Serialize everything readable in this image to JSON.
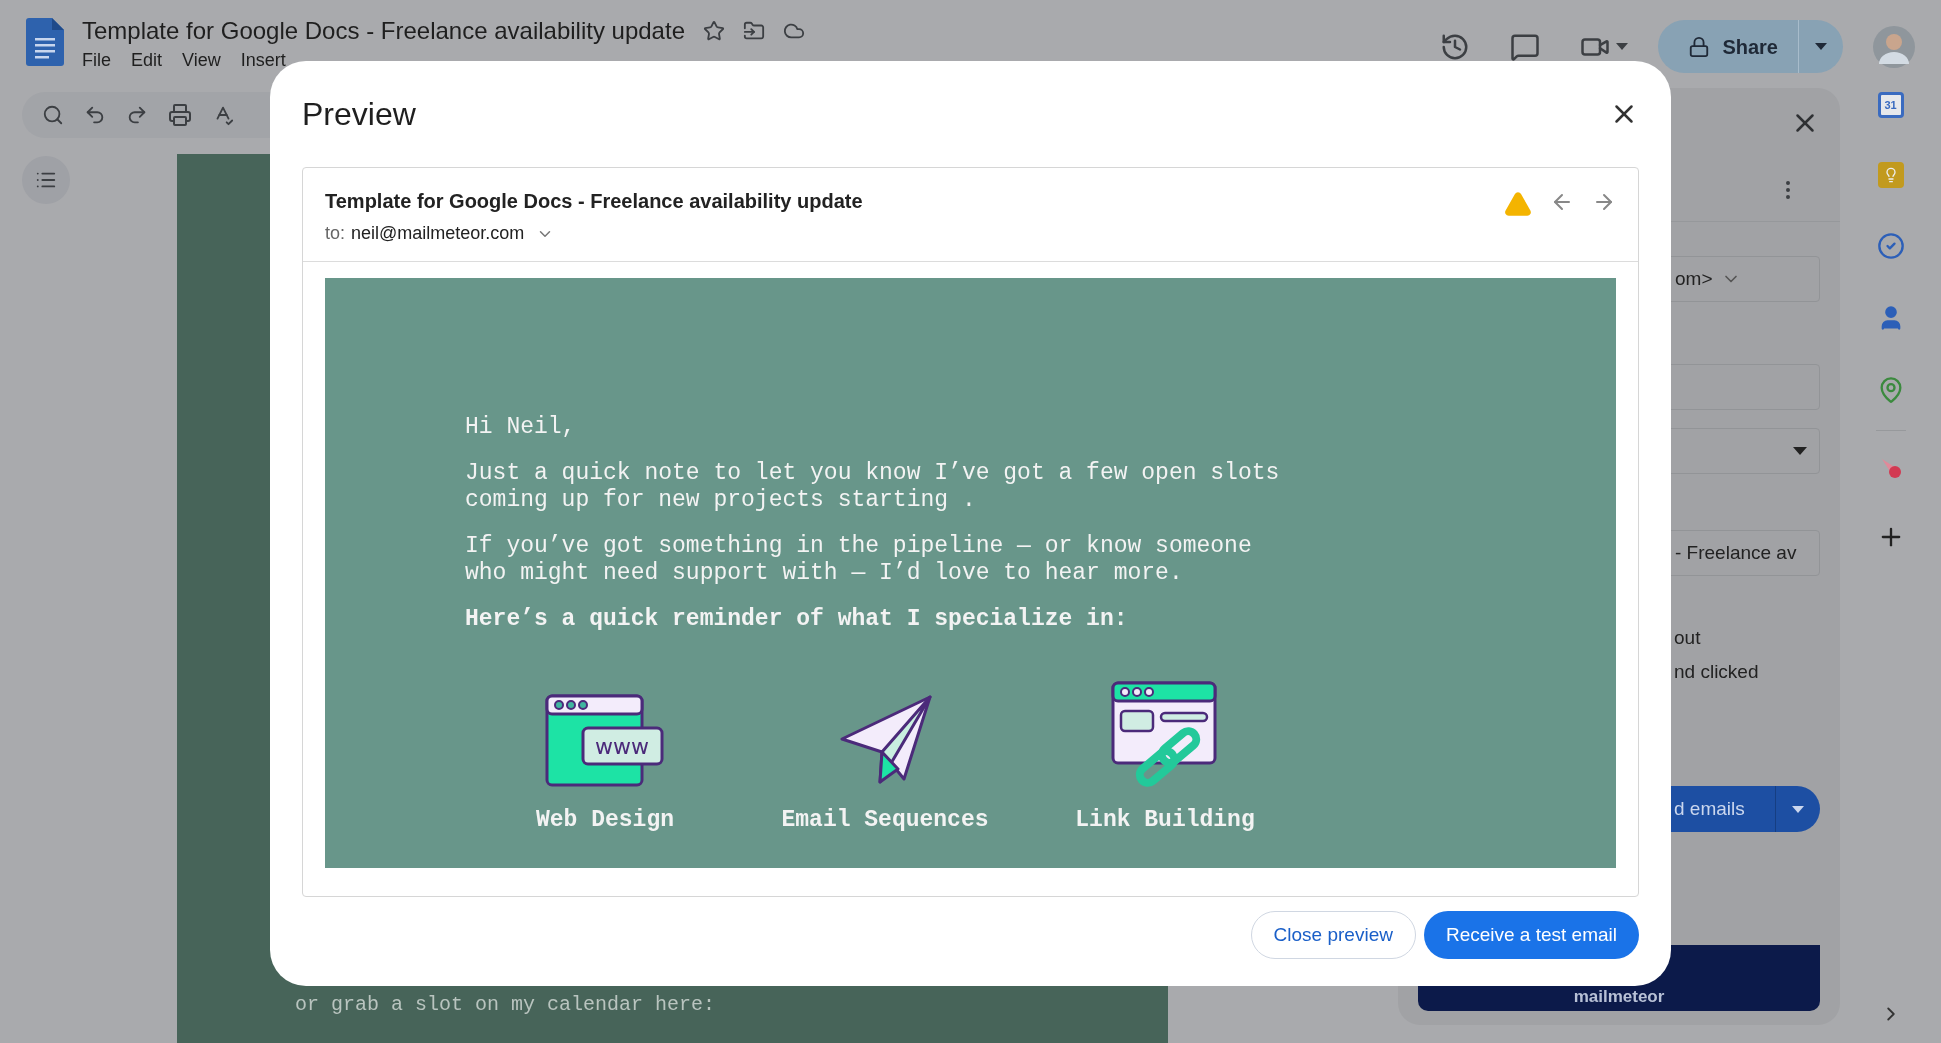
{
  "doc": {
    "title": "Template for Google Docs - Freelance availability update",
    "starred": false,
    "menu": [
      "File",
      "Edit",
      "View",
      "Insert"
    ],
    "body_text": "or grab a slot on my calendar here:"
  },
  "share": {
    "label": "Share"
  },
  "side_panel": {
    "fields": [
      {
        "kind": "select",
        "value": "om>"
      },
      {
        "kind": "text"
      },
      {
        "kind": "dropdown"
      },
      {
        "kind": "text",
        "value": "- Freelance av"
      }
    ],
    "options": [
      "out",
      "nd clicked"
    ],
    "send_button": "d emails",
    "banner": "mailmeteor"
  },
  "rail": {
    "calendar_day": "31"
  },
  "preview": {
    "title": "Preview",
    "subject": "Template for Google Docs - Freelance availability update",
    "to_label": "to:",
    "to": "neil@mailmeteor.com",
    "greeting": "Hi Neil,",
    "paragraphs": [
      "Just a quick note to let you know I’ve got a few open slots\ncoming up for new projects starting .",
      "If you’ve got something in the pipeline — or know someone\nwho might need support with — I’d love to hear more."
    ],
    "heading": "Here’s a quick reminder of what I specialize in:",
    "services": [
      {
        "kind": "web",
        "label": "Web Design",
        "badge": "www"
      },
      {
        "kind": "plane",
        "label": "Email Sequences"
      },
      {
        "kind": "link",
        "label": "Link Building"
      }
    ],
    "buttons": [
      {
        "kind": "secondary",
        "label": "Close preview"
      },
      {
        "kind": "primary",
        "label": "Receive a test email"
      }
    ]
  }
}
